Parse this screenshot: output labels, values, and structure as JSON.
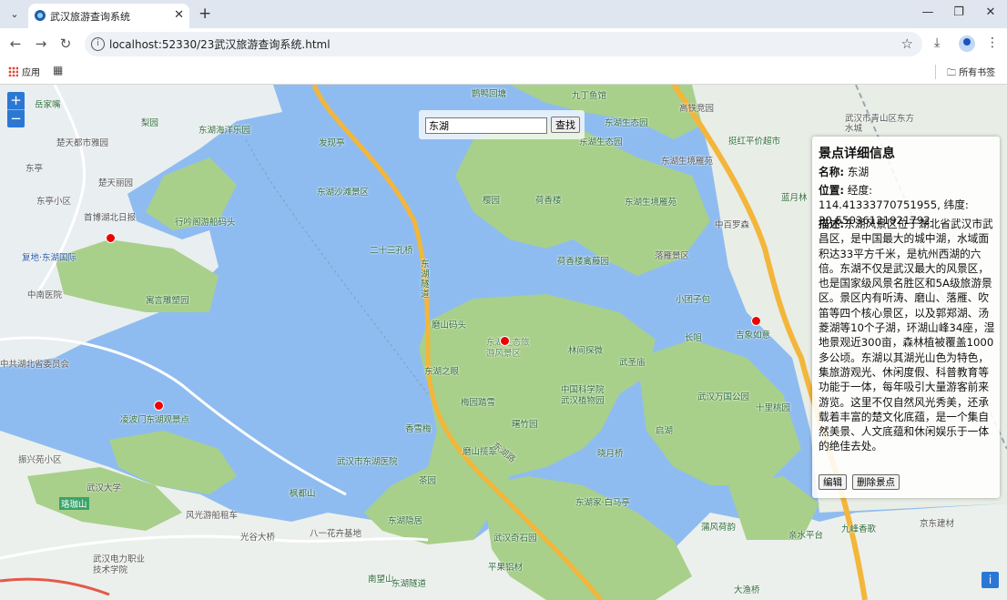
{
  "browser": {
    "tab_title": "武汉旅游查询系统",
    "url": "localhost:52330/23武汉旅游查询系统.html",
    "bookmarks": {
      "apps_label": "应用",
      "all_bookmarks_label": "所有书签"
    }
  },
  "map": {
    "zoom_in": "+",
    "zoom_out": "−",
    "info_label": "i",
    "labels": [
      {
        "id": "l1",
        "text": "岳家嘴"
      },
      {
        "id": "l2",
        "text": "梨园"
      },
      {
        "id": "l3",
        "text": "东湖海洋乐园"
      },
      {
        "id": "l4",
        "text": "楚天都市雅园"
      },
      {
        "id": "l5",
        "text": "东亭"
      },
      {
        "id": "l6",
        "text": "楚天丽园"
      },
      {
        "id": "l7",
        "text": "东亭小区"
      },
      {
        "id": "l8",
        "text": "首博湖北日报"
      },
      {
        "id": "l9",
        "text": "行吟阁游船码头"
      },
      {
        "id": "l10",
        "text": "复地·东湖国际"
      },
      {
        "id": "l11",
        "text": "中南医院"
      },
      {
        "id": "l12",
        "text": "寓言雕塑园"
      },
      {
        "id": "l13",
        "text": "中共湖北省委员会"
      },
      {
        "id": "l14",
        "text": "凌波门东湖观景点"
      },
      {
        "id": "l15",
        "text": "振兴苑小区"
      },
      {
        "id": "l16",
        "text": "武汉大学"
      },
      {
        "id": "l17",
        "text": "珞珈山"
      },
      {
        "id": "l18",
        "text": "风光游船租车"
      },
      {
        "id": "l19",
        "text": "武汉电力职业技术学院"
      },
      {
        "id": "l20",
        "text": "光谷大桥"
      },
      {
        "id": "l21",
        "text": "八一花卉基地"
      },
      {
        "id": "l22",
        "text": "南望山"
      },
      {
        "id": "l23",
        "text": "发现亭"
      },
      {
        "id": "l24",
        "text": "东湖沙滩景区"
      },
      {
        "id": "l25",
        "text": "二十三孔桥"
      },
      {
        "id": "l26",
        "text": "东湖隧道"
      },
      {
        "id": "l27",
        "text": "磨山码头"
      },
      {
        "id": "l28",
        "text": "东湖之眼"
      },
      {
        "id": "l29",
        "text": "梅园踏雪"
      },
      {
        "id": "l30",
        "text": "香雪梅"
      },
      {
        "id": "l31",
        "text": "磨山揽翠"
      },
      {
        "id": "l32",
        "text": "茶园"
      },
      {
        "id": "l33",
        "text": "武汉市东湖医院"
      },
      {
        "id": "l34",
        "text": "枫都山"
      },
      {
        "id": "l35",
        "text": "东湖隐居"
      },
      {
        "id": "l36",
        "text": "武汉奇石园"
      },
      {
        "id": "l37",
        "text": "平果铝材"
      },
      {
        "id": "l38",
        "text": "东湖生态园"
      },
      {
        "id": "l39",
        "text": "樱园"
      },
      {
        "id": "l40",
        "text": "荷香楼"
      },
      {
        "id": "l41",
        "text": "东湖生境雁苑"
      },
      {
        "id": "l42",
        "text": "落雁景区"
      },
      {
        "id": "l43",
        "text": "荷香楼禽藤园"
      },
      {
        "id": "l44",
        "text": "东湖生态旅游风景区"
      },
      {
        "id": "l45",
        "text": "林间探微"
      },
      {
        "id": "l46",
        "text": "武圣庙"
      },
      {
        "id": "l47",
        "text": "中国科学院武汉植物园"
      },
      {
        "id": "l48",
        "text": "曙竹园"
      },
      {
        "id": "l49",
        "text": "晓月桥"
      },
      {
        "id": "l50",
        "text": "东湖家·白马亭"
      },
      {
        "id": "l51",
        "text": "启湖"
      },
      {
        "id": "l52",
        "text": "武汉万国公园"
      },
      {
        "id": "l53",
        "text": "十里桃园"
      },
      {
        "id": "l54",
        "text": "长咀"
      },
      {
        "id": "l55",
        "text": "吉象如意"
      },
      {
        "id": "l56",
        "text": "小团子包"
      },
      {
        "id": "l57",
        "text": "高铁竞园"
      },
      {
        "id": "l58",
        "text": "东湖生境雁苑"
      },
      {
        "id": "l59",
        "text": "中百罗森"
      },
      {
        "id": "l60",
        "text": "蓝月林"
      },
      {
        "id": "l61",
        "text": "蒲风荷韵"
      },
      {
        "id": "l62",
        "text": "九峰香歌"
      },
      {
        "id": "l63",
        "text": "亲水平台"
      },
      {
        "id": "l64",
        "text": "京东建材"
      },
      {
        "id": "l65",
        "text": "武汉市青山区东方水城"
      },
      {
        "id": "l66",
        "text": "鹊鸭回塘"
      },
      {
        "id": "l67",
        "text": "九丁鱼馆"
      },
      {
        "id": "l68",
        "text": "挺红平价超市"
      },
      {
        "id": "l69",
        "text": "东湖生态园"
      },
      {
        "id": "l70",
        "text": "大渔桥"
      },
      {
        "id": "l71",
        "text": "东湖路"
      },
      {
        "id": "l72",
        "text": "东湖隧道"
      }
    ]
  },
  "search": {
    "input_value": "东湖",
    "button_label": "查找"
  },
  "detail": {
    "title": "景点详细信息",
    "name_label": "名称:",
    "name_value": "东湖",
    "position_label": "位置:",
    "position_value": "经度: 114.41333770751955, 纬度: 30.55036121921792",
    "desc_label": "描述:",
    "desc_value": "东湖风景区位于湖北省武汉市武昌区，是中国最大的城中湖，水域面积达33平方千米，是杭州西湖的六倍。东湖不仅是武汉最大的风景区，也是国家级风景名胜区和5A级旅游景区。景区内有听涛、磨山、落雁、吹笛等四个核心景区，以及郭郑湖、汤菱湖等10个子湖，环湖山峰34座，湿地景观近300亩，森林植被覆盖1000多公顷。东湖以其湖光山色为特色，集旅游观光、休闲度假、科普教育等功能于一体，每年吸引大量游客前来游览。这里不仅自然风光秀美，还承载着丰富的楚文化底蕴，是一个集自然美景、人文底蕴和休闲娱乐于一体的绝佳去处。",
    "edit_button": "编辑",
    "delete_button": "删除景点"
  }
}
